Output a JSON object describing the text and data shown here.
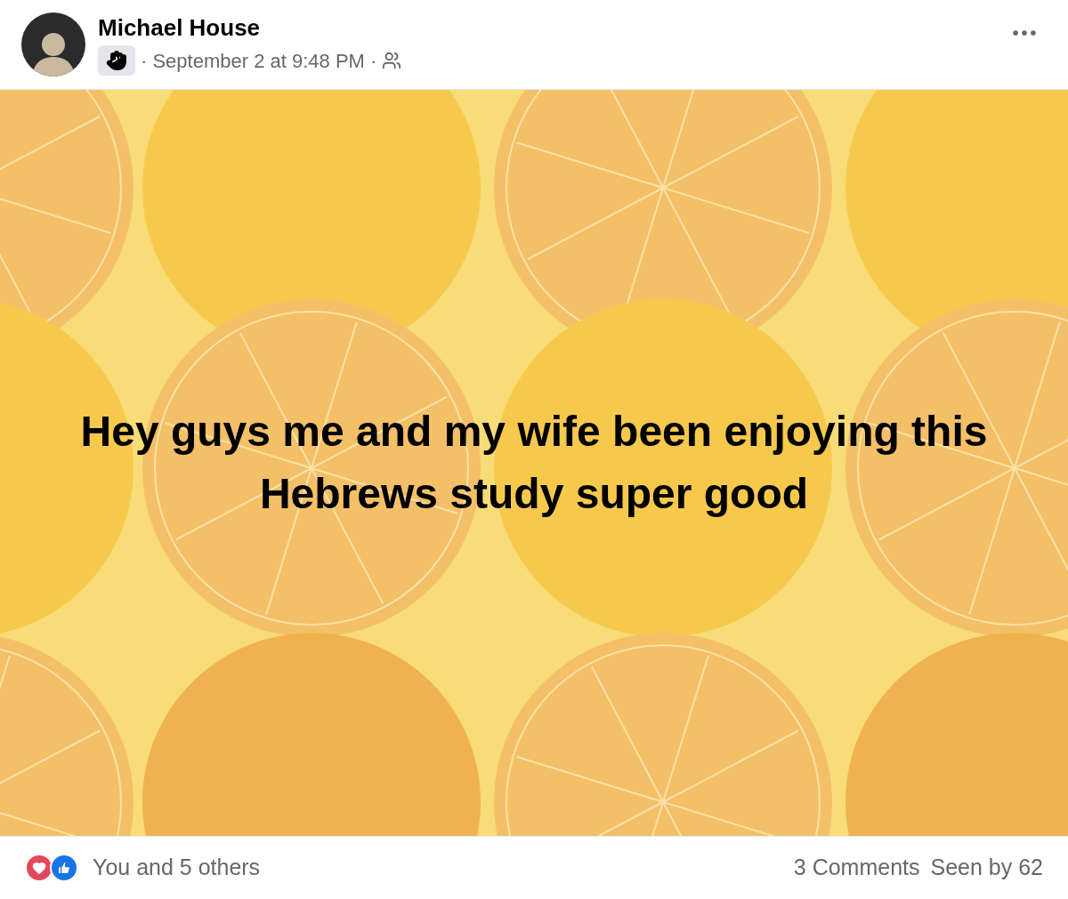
{
  "post": {
    "author": "Michael House",
    "timestamp": "· September 2 at 9:48 PM ·",
    "text": "Hey guys me and my wife been enjoying this Hebrews study super good"
  },
  "footer": {
    "reactions": "You and 5 others",
    "comments": "3 Comments",
    "seen": "Seen by 62"
  }
}
